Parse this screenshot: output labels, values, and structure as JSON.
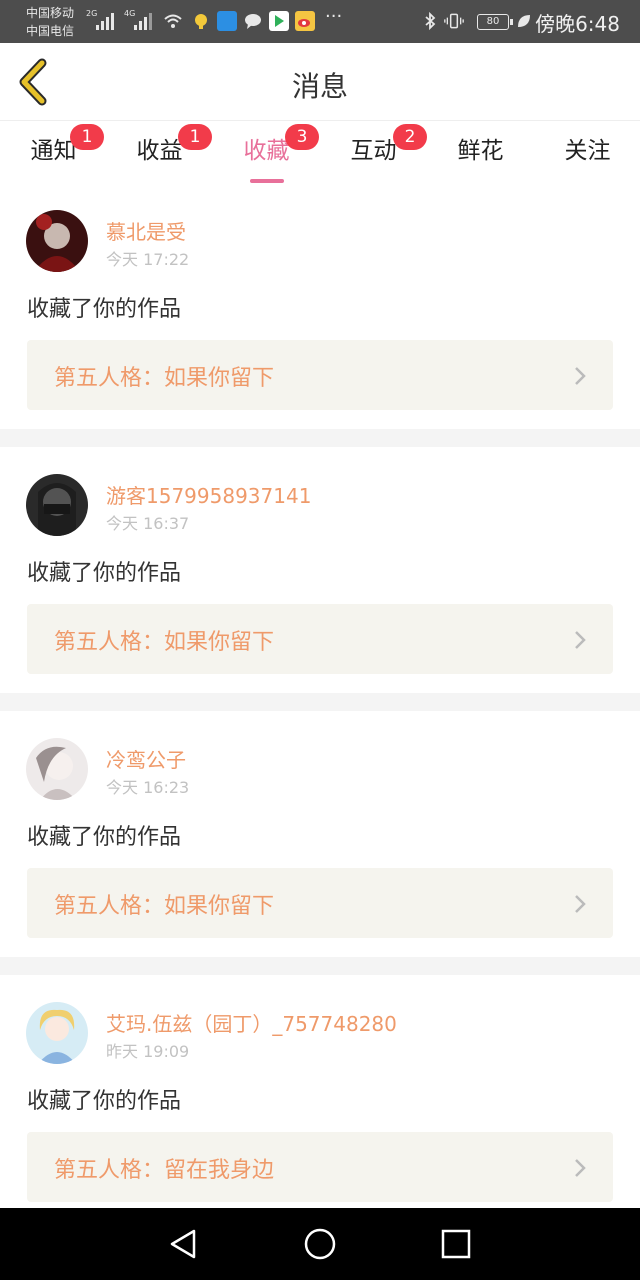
{
  "status_bar": {
    "carrier_1": "中国移动",
    "carrier_2": "中国电信",
    "net_1": "2G",
    "net_2": "4G",
    "more": "···",
    "battery": "80",
    "time": "傍晚6:48",
    "icons": [
      "signal-icon",
      "wifi-icon",
      "bulb-icon",
      "wifi-hotspot-icon",
      "chat-icon",
      "play-store-icon",
      "weibo-icon",
      "bluetooth-icon",
      "vibrate-icon",
      "battery-icon",
      "leaf-icon"
    ]
  },
  "header": {
    "title": "消息",
    "back_icon": "back-chevron-icon",
    "accent": "#e6c12a"
  },
  "tabs": [
    {
      "label": "通知",
      "badge": "1"
    },
    {
      "label": "收益",
      "badge": "1"
    },
    {
      "label": "收藏",
      "badge": "3",
      "active": true
    },
    {
      "label": "互动",
      "badge": "2"
    },
    {
      "label": "鲜花",
      "badge": ""
    },
    {
      "label": "关注",
      "badge": ""
    }
  ],
  "colors": {
    "active_tab": "#e8709a",
    "badge": "#f23b4a",
    "username": "#ef9a6a",
    "work_title": "#ef9a6a",
    "work_box_bg": "#f5f4ee"
  },
  "feed": [
    {
      "username": "慕北是受",
      "time": "今天 17:22",
      "action": "收藏了你的作品",
      "work": "第五人格：如果你留下"
    },
    {
      "username": "游客1579958937141",
      "time": "今天 16:37",
      "action": "收藏了你的作品",
      "work": "第五人格：如果你留下"
    },
    {
      "username": "冷鸾公子",
      "time": "今天 16:23",
      "action": "收藏了你的作品",
      "work": "第五人格：如果你留下"
    },
    {
      "username": "艾玛.伍兹（园丁）_757748280",
      "time": "昨天 19:09",
      "action": "收藏了你的作品",
      "work": "第五人格：留在我身边"
    }
  ],
  "nav": {
    "icons": [
      "back-triangle-icon",
      "home-circle-icon",
      "recents-square-icon"
    ]
  }
}
